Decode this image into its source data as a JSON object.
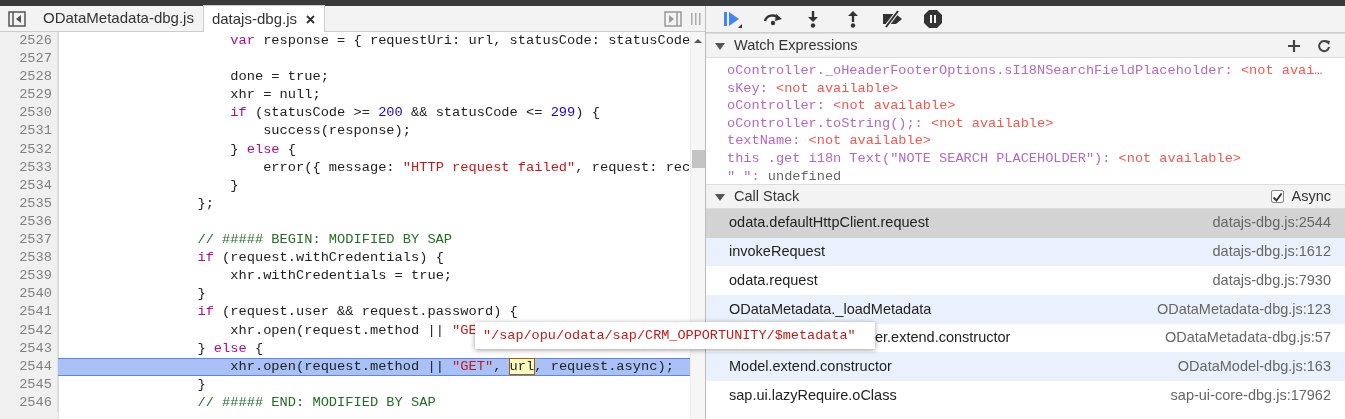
{
  "editor_tabs": [
    {
      "label": "ODataMetadata-dbg.js",
      "selected": false,
      "closable": false
    },
    {
      "label": "datajs-dbg.js",
      "selected": true,
      "closable": true
    }
  ],
  "code_lines": [
    {
      "number": "2526",
      "current": false,
      "tokens": [
        {
          "kind": "keyword",
          "text": "                    var"
        },
        {
          "kind": "plain",
          "text": " response = { requestUri: url, statusCode: statusCode"
        }
      ]
    },
    {
      "number": "2527",
      "current": false
    },
    {
      "number": "2528",
      "current": false,
      "tokens": [
        {
          "kind": "plain",
          "text": "                    done = true;"
        }
      ]
    },
    {
      "number": "2529",
      "current": false,
      "tokens": [
        {
          "kind": "plain",
          "text": "                    xhr = null;"
        }
      ]
    },
    {
      "number": "2530",
      "current": false,
      "tokens": [
        {
          "kind": "keyword",
          "text": "                    if"
        },
        {
          "kind": "plain",
          "text": " (statusCode >= "
        },
        {
          "kind": "number",
          "text": "200"
        },
        {
          "kind": "plain",
          "text": " && statusCode <= "
        },
        {
          "kind": "number",
          "text": "299"
        },
        {
          "kind": "plain",
          "text": ") {"
        }
      ]
    },
    {
      "number": "2531",
      "current": false,
      "tokens": [
        {
          "kind": "plain",
          "text": "                        success(response);"
        }
      ]
    },
    {
      "number": "2532",
      "current": false,
      "tokens": [
        {
          "kind": "plain",
          "text": "                    } "
        },
        {
          "kind": "keyword",
          "text": "else"
        },
        {
          "kind": "plain",
          "text": " {"
        }
      ]
    },
    {
      "number": "2533",
      "current": false,
      "tokens": [
        {
          "kind": "plain",
          "text": "                        error({ message: "
        },
        {
          "kind": "string",
          "text": "\"HTTP request failed\""
        },
        {
          "kind": "plain",
          "text": ", request: rec"
        }
      ]
    },
    {
      "number": "2534",
      "current": false,
      "tokens": [
        {
          "kind": "plain",
          "text": "                    }"
        }
      ]
    },
    {
      "number": "2535",
      "current": false,
      "tokens": [
        {
          "kind": "plain",
          "text": "                };"
        }
      ]
    },
    {
      "number": "2536",
      "current": false
    },
    {
      "number": "2537",
      "current": false,
      "tokens": [
        {
          "kind": "comment",
          "text": "                // ##### BEGIN: MODIFIED BY SAP"
        }
      ]
    },
    {
      "number": "2538",
      "current": false,
      "tokens": [
        {
          "kind": "keyword",
          "text": "                if"
        },
        {
          "kind": "plain",
          "text": " (request.withCredentials) {"
        }
      ]
    },
    {
      "number": "2539",
      "current": false,
      "tokens": [
        {
          "kind": "plain",
          "text": "                    xhr.withCredentials = true;"
        }
      ]
    },
    {
      "number": "2540",
      "current": false,
      "tokens": [
        {
          "kind": "plain",
          "text": "                }"
        }
      ]
    },
    {
      "number": "2541",
      "current": false,
      "tokens": [
        {
          "kind": "keyword",
          "text": "                if"
        },
        {
          "kind": "plain",
          "text": " (request.user && request.password) {"
        }
      ]
    },
    {
      "number": "2542",
      "current": false,
      "tokens": [
        {
          "kind": "plain",
          "text": "                    xhr.open(request.method || "
        },
        {
          "kind": "string",
          "text": "\"GE"
        }
      ]
    },
    {
      "number": "2543",
      "current": false,
      "tokens": [
        {
          "kind": "plain",
          "text": "                } "
        },
        {
          "kind": "keyword",
          "text": "else"
        },
        {
          "kind": "plain",
          "text": " {"
        }
      ]
    },
    {
      "number": "2544",
      "current": true,
      "tokens": [
        {
          "kind": "plain",
          "text": "                    xhr.open(request.method || "
        },
        {
          "kind": "string",
          "text": "\"GET\""
        },
        {
          "kind": "plain",
          "text": ", "
        },
        {
          "kind": "hovered",
          "text": "url"
        },
        {
          "kind": "plain",
          "text": ", request.async);"
        }
      ]
    },
    {
      "number": "2545",
      "current": false,
      "tokens": [
        {
          "kind": "plain",
          "text": "                }"
        }
      ]
    },
    {
      "number": "2546",
      "current": false,
      "tokens": [
        {
          "kind": "comment",
          "text": "                // ##### END: MODIFIED BY SAP"
        }
      ]
    }
  ],
  "hover_tooltip": {
    "text": "\"/sap/opu/odata/sap/CRM_OPPORTUNITY/$metadata\""
  },
  "watch_expressions": {
    "title": "Watch Expressions",
    "expanded": true,
    "items": [
      {
        "name": "oController._oHeaderFooterOptions.sI18NSearchFieldPlaceholder:",
        "value": "<not avai…",
        "kind": "error"
      },
      {
        "name": "sKey:",
        "value": "<not available>",
        "kind": "error"
      },
      {
        "name": "oController:",
        "value": "<not available>",
        "kind": "error"
      },
      {
        "name": "oController.toString();:",
        "value": "<not available>",
        "kind": "error"
      },
      {
        "name": "textName:",
        "value": "<not available>",
        "kind": "error"
      },
      {
        "name": "this .get i18n Text(\"NOTE SEARCH PLACEHOLDER\"):",
        "value": "<not available>",
        "kind": "error"
      },
      {
        "name": "\" \":",
        "value": "undefined",
        "kind": "plain"
      }
    ]
  },
  "call_stack": {
    "title": "Call Stack",
    "expanded": true,
    "async": {
      "label": "Async",
      "checked": true
    },
    "frames": [
      {
        "function": "odata.defaultHttpClient.request",
        "location": "datajs-dbg.js:2544",
        "selected": true,
        "covered": false
      },
      {
        "function": "invokeRequest",
        "location": "datajs-dbg.js:1612",
        "selected": false,
        "covered": false
      },
      {
        "function": "odata.request",
        "location": "datajs-dbg.js:7930",
        "selected": false,
        "covered": false
      },
      {
        "function": "ODataMetadata._loadMetadata",
        "location": "ODataMetadata-dbg.js:123",
        "selected": false,
        "covered": false
      },
      {
        "function": "er.extend.constructor",
        "location": "ODataMetadata-dbg.js:57",
        "selected": false,
        "covered": true
      },
      {
        "function": "Model.extend.constructor",
        "location": "ODataModel-dbg.js:163",
        "selected": false,
        "covered": false
      },
      {
        "function": "sap.ui.lazyRequire.oClass",
        "location": "sap-ui-core-dbg.js:17962",
        "selected": false,
        "covered": false
      }
    ]
  }
}
